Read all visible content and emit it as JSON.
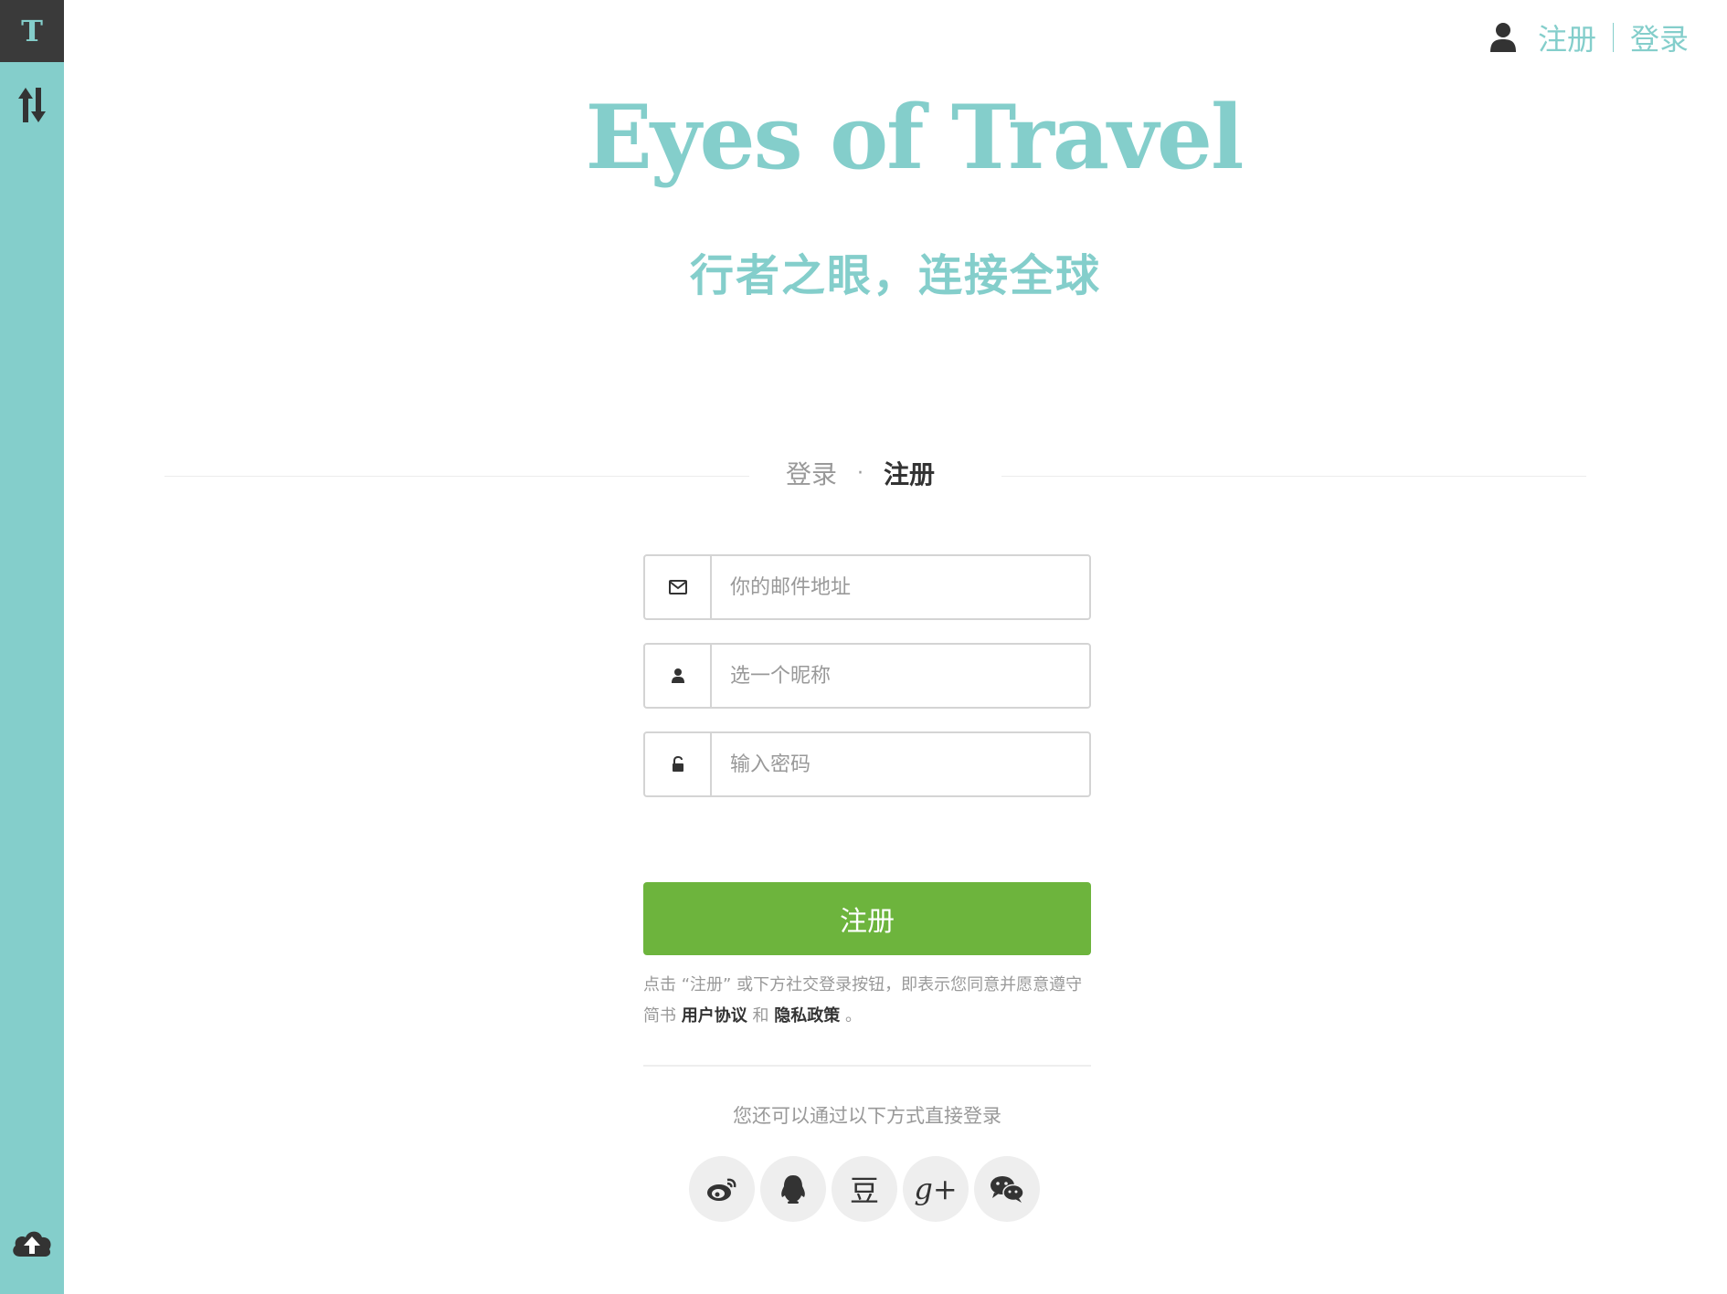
{
  "sidebar": {
    "logo_letter": "T"
  },
  "top_nav": {
    "register_label": "注册",
    "login_label": "登录"
  },
  "hero": {
    "title": "Eyes of Travel",
    "subtitle": "行者之眼，连接全球"
  },
  "tabs": {
    "login_label": "登录",
    "separator": "·",
    "register_label": "注册",
    "active": "注册"
  },
  "form": {
    "email": {
      "placeholder": "你的邮件地址",
      "value": ""
    },
    "nickname": {
      "placeholder": "选一个昵称",
      "value": ""
    },
    "password": {
      "placeholder": "输入密码",
      "value": ""
    },
    "submit_label": "注册",
    "agreement": {
      "prefix": "点击 “注册” 或下方社交登录按钮，即表示您同意并愿意遵守简书",
      "user_agreement": "用户协议",
      "and": "和",
      "privacy_policy": "隐私政策",
      "suffix": "。"
    }
  },
  "social": {
    "hint": "您还可以通过以下方式直接登录",
    "providers": [
      "weibo-icon",
      "qq-icon",
      "douban-icon",
      "google-plus-icon",
      "wechat-icon"
    ],
    "douban_glyph": "豆",
    "google_glyph": "g+"
  },
  "colors": {
    "accent": "#84cecb",
    "logo_bg": "#3a3a3a",
    "submit": "#6db43d"
  }
}
